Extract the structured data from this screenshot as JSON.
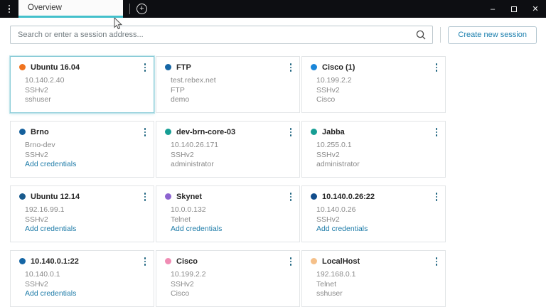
{
  "titlebar": {
    "tab_label": "Overview",
    "minimize_glyph": "–",
    "close_glyph": "✕",
    "newtab_glyph": "+"
  },
  "toolbar": {
    "search_placeholder": "Search or enter a session address...",
    "create_button_label": "Create new session"
  },
  "labels": {
    "add_credentials": "Add credentials"
  },
  "colors": {
    "titlebar_bg": "#0d0e12",
    "tab_underline_accent": "#43c0cb",
    "selected_card_border": "#8bccd8",
    "link_blue": "#1d7ba8",
    "detail_gray": "#8a8a8a"
  },
  "cards": [
    {
      "name": "Ubuntu 16.04",
      "dot_color": "#f0731f",
      "host": "10.140.2.40",
      "protocol": "SSHv2",
      "username": "sshuser",
      "selected": true
    },
    {
      "name": "FTP",
      "dot_color": "#1566a5",
      "host": "test.rebex.net",
      "protocol": "FTP",
      "username": "demo",
      "selected": false
    },
    {
      "name": "Cisco (1)",
      "dot_color": "#1a86d9",
      "host": "10.199.2.2",
      "protocol": "SSHv2",
      "username": "Cisco",
      "selected": false
    },
    {
      "name": "Brno",
      "dot_color": "#15609c",
      "host": "Brno-dev",
      "protocol": "SSHv2",
      "username": null,
      "selected": false
    },
    {
      "name": "dev-brn-core-03",
      "dot_color": "#169e94",
      "host": "10.140.26.171",
      "protocol": "SSHv2",
      "username": "administrator",
      "selected": false
    },
    {
      "name": "Jabba",
      "dot_color": "#169e94",
      "host": "10.255.0.1",
      "protocol": "SSHv2",
      "username": "administrator",
      "selected": false
    },
    {
      "name": "Ubuntu 12.14",
      "dot_color": "#185a8d",
      "host": "192.16.99.1",
      "protocol": "SSHv2",
      "username": null,
      "selected": false
    },
    {
      "name": "Skynet",
      "dot_color": "#8d64d0",
      "host": "10.0.0.132",
      "protocol": "Telnet",
      "username": null,
      "selected": false
    },
    {
      "name": "10.140.0.26:22",
      "dot_color": "#114d8c",
      "host": "10.140.0.26",
      "protocol": "SSHv2",
      "username": null,
      "selected": false
    },
    {
      "name": "10.140.0.1:22",
      "dot_color": "#1566a5",
      "host": "10.140.0.1",
      "protocol": "SSHv2",
      "username": null,
      "selected": false
    },
    {
      "name": "Cisco",
      "dot_color": "#f08cb4",
      "host": "10.199.2.2",
      "protocol": "SSHv2",
      "username": "Cisco",
      "selected": false
    },
    {
      "name": "LocalHost",
      "dot_color": "#f5c089",
      "host": "192.168.0.1",
      "protocol": "Telnet",
      "username": "sshuser",
      "selected": false
    }
  ]
}
